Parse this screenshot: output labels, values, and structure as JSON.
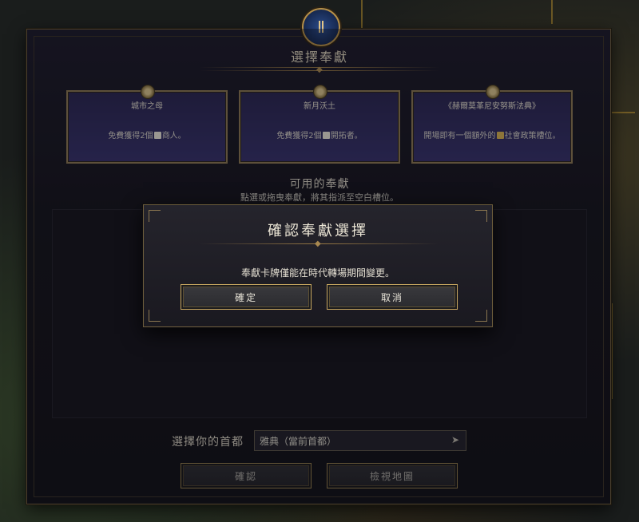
{
  "panel": {
    "title": "選擇奉獻",
    "emblem_icon": "pantheon-icon"
  },
  "cards": [
    {
      "title": "城市之母",
      "description_pre": "免費獲得2個",
      "description_post": "商人。",
      "icon": "merchant-icon"
    },
    {
      "title": "新月沃土",
      "description_pre": "免費獲得2個",
      "description_post": "開拓者。",
      "icon": "settler-icon"
    },
    {
      "title": "《赫爾莫革尼安努斯法典》",
      "description_pre": "開場即有一個額外的",
      "description_post": "社會政策槽位。",
      "icon": "policy-icon"
    }
  ],
  "available": {
    "title": "可用的奉獻",
    "subtitle": "點選或拖曳奉獻，將其指派至空白槽位。"
  },
  "capital": {
    "label": "選擇你的首都",
    "value": "雅典（當前首都）"
  },
  "buttons": {
    "confirm": "確認",
    "view_map": "檢視地圖"
  },
  "modal": {
    "title": "確認奉獻選擇",
    "message": "奉獻卡牌僅能在時代轉場期間變更。",
    "ok": "確定",
    "cancel": "取消"
  },
  "colors": {
    "gold_border": "#c9a860",
    "card_bg": "#36316a"
  }
}
